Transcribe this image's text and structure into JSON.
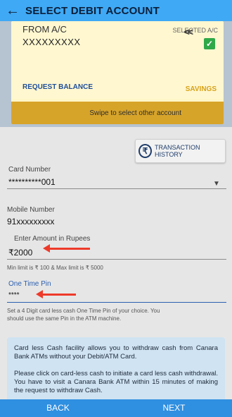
{
  "header": {
    "title": "SELECT DEBIT ACCOUNT"
  },
  "account_card": {
    "from_label": "FROM A/C",
    "selected_label": "SELECTED A/C",
    "account_number": "XXXXXXXXX",
    "check_mark": "✓",
    "request_balance": "REQUEST BALANCE",
    "account_type": "SAVINGS",
    "swipe_text": "Swipe to select other account",
    "swipe_arrows": "<<"
  },
  "transaction_history": {
    "label": "TRANSACTION HISTORY",
    "icon": "history-icon"
  },
  "form": {
    "card_number_label": "Card Number",
    "card_number_value": "**********001",
    "mobile_label": "Mobile Number",
    "mobile_value": "91xxxxxxxxx",
    "amount_label": "Enter Amount in Rupees",
    "amount_value": "₹2000",
    "limit_note": "Min limit is ₹ 100 & Max limit is ₹ 5000",
    "pin_label": "One Time Pin",
    "pin_value": "****",
    "pin_note": "Set a 4 Digit card less cash One Time Pin of your choice. You should use the same Pin in the ATM machine."
  },
  "info": {
    "p1": "Card less Cash facility allows you to withdraw cash from Canara Bank ATMs without your Debit/ATM Card.",
    "p2": "Please click on card-less cash to initiate a card less cash withdrawal. You have to visit a Canara Bank ATM within 15 minutes of making the request to withdraw Cash."
  },
  "footer": {
    "back_label": "BACK",
    "next_label": "NEXT"
  },
  "colors": {
    "header": "#3fa9f5",
    "swipe_strip": "#d7a42a",
    "footer": "#2f8fe0",
    "annotation_arrow": "#ee3a2a"
  }
}
